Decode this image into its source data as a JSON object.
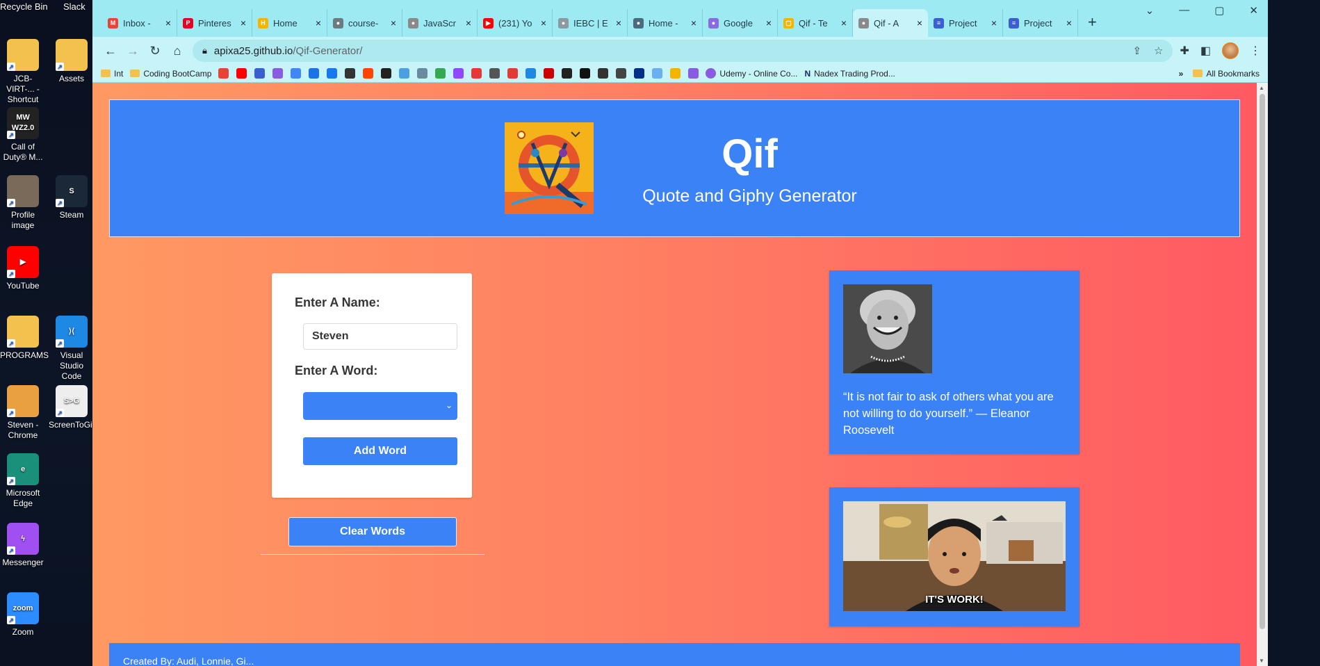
{
  "desktop": {
    "top_labels": [
      "Recycle Bin",
      "Slack"
    ],
    "icons": [
      {
        "label": "JCB-VIRT-... - Shortcut",
        "color": "#f2c14e",
        "glyph": ""
      },
      {
        "label": "Assets",
        "color": "#f2c14e",
        "glyph": ""
      },
      {
        "label": "Call of Duty® M...",
        "color": "#222222",
        "glyph": "MW WZ2.0"
      },
      {
        "label": "Profile image",
        "color": "#7a6a5a",
        "glyph": ""
      },
      {
        "label": "Steam",
        "color": "#1b2838",
        "glyph": "S"
      },
      {
        "label": "YouTube",
        "color": "#ff0000",
        "glyph": "▶"
      },
      {
        "label": "PROGRAMS",
        "color": "#f2c14e",
        "glyph": ""
      },
      {
        "label": "Visual Studio Code",
        "color": "#1e88e5",
        "glyph": "⟩⟨"
      },
      {
        "label": "Steven - Chrome",
        "color": "#e8a040",
        "glyph": ""
      },
      {
        "label": "ScreenToGif",
        "color": "#eeeeee",
        "glyph": "S>G"
      },
      {
        "label": "Microsoft Edge",
        "color": "#1a8f7a",
        "glyph": "e"
      },
      {
        "label": "Messenger",
        "color": "#a050f0",
        "glyph": "ϟ"
      },
      {
        "label": "Zoom",
        "color": "#2d8cff",
        "glyph": "zoom"
      }
    ]
  },
  "browser": {
    "tabs": [
      {
        "label": "Inbox -",
        "fav_color": "#ea4335",
        "fav_glyph": "M"
      },
      {
        "label": "Pinteres",
        "fav_color": "#e60023",
        "fav_glyph": "P"
      },
      {
        "label": "Home",
        "fav_color": "#f4b400",
        "fav_glyph": "H"
      },
      {
        "label": "course-",
        "fav_color": "#6b7b7f",
        "fav_glyph": "●"
      },
      {
        "label": "JavaScr",
        "fav_color": "#8a8a8a",
        "fav_glyph": "●"
      },
      {
        "label": "(231) Yo",
        "fav_color": "#ff0000",
        "fav_glyph": "▶"
      },
      {
        "label": "IEBC | E",
        "fav_color": "#8a9aa0",
        "fav_glyph": "●"
      },
      {
        "label": "Home -",
        "fav_color": "#4a6a80",
        "fav_glyph": "●"
      },
      {
        "label": "Google",
        "fav_color": "#8a6ae0",
        "fav_glyph": "●"
      },
      {
        "label": "Qif - Te",
        "fav_color": "#f4b400",
        "fav_glyph": "▢"
      },
      {
        "label": "Qif - A",
        "fav_color": "#8a8a8a",
        "fav_glyph": "●",
        "active": true
      },
      {
        "label": "Project",
        "fav_color": "#3b5fd0",
        "fav_glyph": "≡"
      },
      {
        "label": "Project",
        "fav_color": "#3b5fd0",
        "fav_glyph": "≡"
      }
    ],
    "tab_close": "×",
    "new_tab": "+",
    "window_controls": {
      "minimize": "—",
      "maximize": "▢",
      "close": "✕"
    },
    "url_host": "apixa25.github.io",
    "url_path": "/Qif-Generator/",
    "bookmarks": [
      {
        "label": "Int",
        "type": "folder"
      },
      {
        "label": "Coding BootCamp",
        "type": "folder"
      }
    ],
    "bookmark_icons": [
      "#ea4335",
      "#ff0000",
      "#3b5fd0",
      "#8a5ae0",
      "#4285f4",
      "#1a73e8",
      "#1877f2",
      "#333333",
      "#ff4500",
      "#222222",
      "#4aa0e0",
      "#6a8aa0",
      "#34a853",
      "#9146ff",
      "#e53935",
      "#555555",
      "#e53935",
      "#1e88e5",
      "#cc0000",
      "#222222",
      "#111111",
      "#333333",
      "#444444",
      "#003087",
      "#6ab0f0",
      "#f4b400",
      "#8a5ae0"
    ],
    "bookmarks_after_icons": [
      {
        "label": "Udemy - Online Co..."
      },
      {
        "label": "Nadex Trading Prod..."
      }
    ],
    "all_bookmarks": "All Bookmarks",
    "bookmark_overflow": "»"
  },
  "page": {
    "title": "Qif",
    "subtitle": "Quote and Giphy Generator",
    "form": {
      "name_label": "Enter A Name:",
      "name_value": "Steven",
      "word_label": "Enter A Word:",
      "word_selected": "",
      "add_word_label": "Add Word"
    },
    "clear_words_label": "Clear Words",
    "quote": {
      "text": "“It is not fair to ask of others what you are not willing to do yourself.” — Eleanor Roosevelt"
    },
    "gif": {
      "caption": "IT'S WORK!"
    },
    "footer": {
      "text": "Created By: Audi, Lonnie, Gi..."
    },
    "colors": {
      "accent": "#3b82f6",
      "gradient_start": "#ff9962",
      "gradient_end": "#ff5a62"
    }
  }
}
